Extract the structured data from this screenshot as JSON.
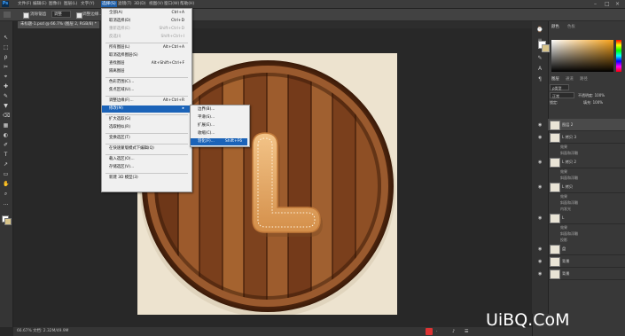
{
  "menubar": {
    "app_icon": "Ps",
    "items": [
      "文件(F)",
      "编辑(E)",
      "图像(I)",
      "图层(L)",
      "文字(Y)",
      "选择(S)",
      "滤镜(T)",
      "3D(D)",
      "视图(V)",
      "窗口(W)",
      "帮助(H)"
    ]
  },
  "options": {
    "mode_label": "消除锯齿",
    "style_value": "调整",
    "button_label": "调整边缘..."
  },
  "tab": {
    "title": "未标题-1.psd @ 66.7% (图层 2, RGB/8) *"
  },
  "status": {
    "text": "66.67%   文档: 2.32M/49.9M"
  },
  "select_menu": {
    "items": [
      {
        "label": "全部(A)",
        "shortcut": "Ctrl+A"
      },
      {
        "label": "取消选择(D)",
        "shortcut": "Ctrl+D"
      },
      {
        "label": "重新选择(E)",
        "shortcut": "Shift+Ctrl+D"
      },
      {
        "label": "反选(I)",
        "shortcut": "Shift+Ctrl+I"
      },
      {
        "label": "所有图层(L)",
        "shortcut": "Alt+Ctrl+A"
      },
      {
        "label": "取消选择图层(S)",
        "shortcut": ""
      },
      {
        "label": "查找图层",
        "shortcut": "Alt+Shift+Ctrl+F"
      },
      {
        "label": "隔离图层",
        "shortcut": ""
      },
      {
        "label": "色彩范围(C)...",
        "shortcut": ""
      },
      {
        "label": "焦点区域(U)...",
        "shortcut": ""
      },
      {
        "label": "调整边缘(F)...",
        "shortcut": "Alt+Ctrl+R"
      },
      {
        "label": "修改(M)",
        "shortcut": "▸"
      },
      {
        "label": "扩大选取(G)",
        "shortcut": ""
      },
      {
        "label": "选取相似(R)",
        "shortcut": ""
      },
      {
        "label": "变换选区(T)",
        "shortcut": ""
      },
      {
        "label": "在快速蒙版模式下编辑(Q)",
        "shortcut": ""
      },
      {
        "label": "载入选区(O)...",
        "shortcut": ""
      },
      {
        "label": "存储选区(V)...",
        "shortcut": ""
      },
      {
        "label": "新建 3D 模型(3)",
        "shortcut": ""
      }
    ]
  },
  "modify_menu": {
    "items": [
      {
        "label": "边界(B)...",
        "shortcut": ""
      },
      {
        "label": "平滑(S)...",
        "shortcut": ""
      },
      {
        "label": "扩展(E)...",
        "shortcut": ""
      },
      {
        "label": "收缩(C)...",
        "shortcut": ""
      },
      {
        "label": "羽化(F)...",
        "shortcut": "Shift+F6"
      }
    ]
  },
  "panels": {
    "color_tabs": [
      "颜色",
      "色板"
    ],
    "layers_tabs": [
      "图层",
      "通道",
      "路径"
    ],
    "kind_label": "ρ类型",
    "blend_mode": "正常",
    "opacity": "不透明度: 100%",
    "lock_label": "锁定:",
    "fill": "填充: 100%",
    "layers": [
      {
        "name": "图层 2",
        "fx": []
      },
      {
        "name": "L 拷贝 3",
        "fx": [
          "效果",
          "斜面和浮雕"
        ]
      },
      {
        "name": "L 拷贝 2",
        "fx": [
          "效果",
          "斜面和浮雕"
        ]
      },
      {
        "name": "L 拷贝",
        "fx": [
          "效果",
          "斜面和浮雕",
          "内发光"
        ]
      },
      {
        "name": "L",
        "fx": [
          "效果",
          "斜面和浮雕",
          "投影"
        ]
      },
      {
        "name": "盘",
        "fx": []
      },
      {
        "name": "背景",
        "fx": []
      },
      {
        "name": "背景",
        "fx": []
      }
    ]
  },
  "watermark": "UiBQ.CoM",
  "colors": {
    "wood_dark": "#5a2e14",
    "wood_light": "#a8683a",
    "cookie": "#e3a766",
    "menu_highlight": "#1b63b8",
    "canvas_bg": "#ede3cf"
  }
}
